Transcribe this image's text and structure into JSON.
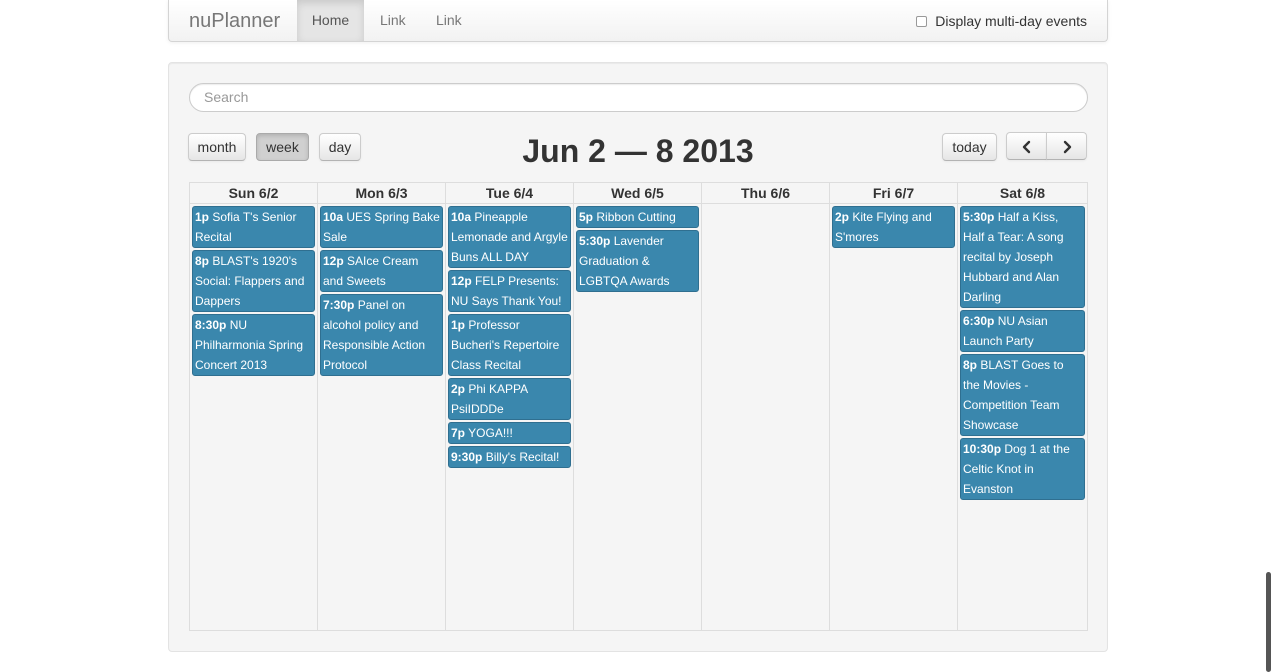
{
  "navbar": {
    "brand": "nuPlanner",
    "links": [
      "Home",
      "Link",
      "Link"
    ],
    "multiday_label": "Display multi-day events"
  },
  "search": {
    "placeholder": "Search"
  },
  "toolbar": {
    "month": "month",
    "week": "week",
    "day": "day",
    "title": "Jun 2 — 8 2013",
    "today": "today",
    "prev_icon": "chevron-left-icon",
    "next_icon": "chevron-right-icon"
  },
  "colors": {
    "event": "#3a87ad",
    "grid_bg": "#f5f5f5"
  },
  "calendar": {
    "days": [
      {
        "header": "Sun 6/2",
        "events": [
          {
            "time": "1p",
            "title": "Sofia T's Senior Recital"
          },
          {
            "time": "8p",
            "title": "BLAST's 1920's Social: Flappers and Dappers"
          },
          {
            "time": "8:30p",
            "title": "NU Philharmonia Spring Concert 2013"
          }
        ]
      },
      {
        "header": "Mon 6/3",
        "events": [
          {
            "time": "10a",
            "title": "UES Spring Bake Sale"
          },
          {
            "time": "12p",
            "title": "SAIce Cream and Sweets"
          },
          {
            "time": "7:30p",
            "title": "Panel on alcohol policy and Responsible Action Protocol"
          }
        ]
      },
      {
        "header": "Tue 6/4",
        "events": [
          {
            "time": "10a",
            "title": "Pineapple Lemonade and Argyle Buns ALL DAY"
          },
          {
            "time": "12p",
            "title": "FELP Presents: NU Says Thank You!"
          },
          {
            "time": "1p",
            "title": "Professor Bucheri's Repertoire Class Recital"
          },
          {
            "time": "2p",
            "title": "Phi KAPPA PsiIDDDe"
          },
          {
            "time": "7p",
            "title": "YOGA!!!"
          },
          {
            "time": "9:30p",
            "title": "Billy's Recital!"
          }
        ]
      },
      {
        "header": "Wed 6/5",
        "events": [
          {
            "time": "5p",
            "title": "Ribbon Cutting"
          },
          {
            "time": "5:30p",
            "title": "Lavender Graduation & LGBTQA Awards"
          }
        ]
      },
      {
        "header": "Thu 6/6",
        "events": []
      },
      {
        "header": "Fri 6/7",
        "events": [
          {
            "time": "2p",
            "title": "Kite Flying and S'mores"
          }
        ]
      },
      {
        "header": "Sat 6/8",
        "events": [
          {
            "time": "5:30p",
            "title": "Half a Kiss, Half a Tear: A song recital by Joseph Hubbard and Alan Darling"
          },
          {
            "time": "6:30p",
            "title": "NU Asian Launch Party"
          },
          {
            "time": "8p",
            "title": "BLAST Goes to the Movies - Competition Team Showcase"
          },
          {
            "time": "10:30p",
            "title": "Dog 1 at the Celtic Knot in Evanston"
          }
        ]
      }
    ]
  }
}
